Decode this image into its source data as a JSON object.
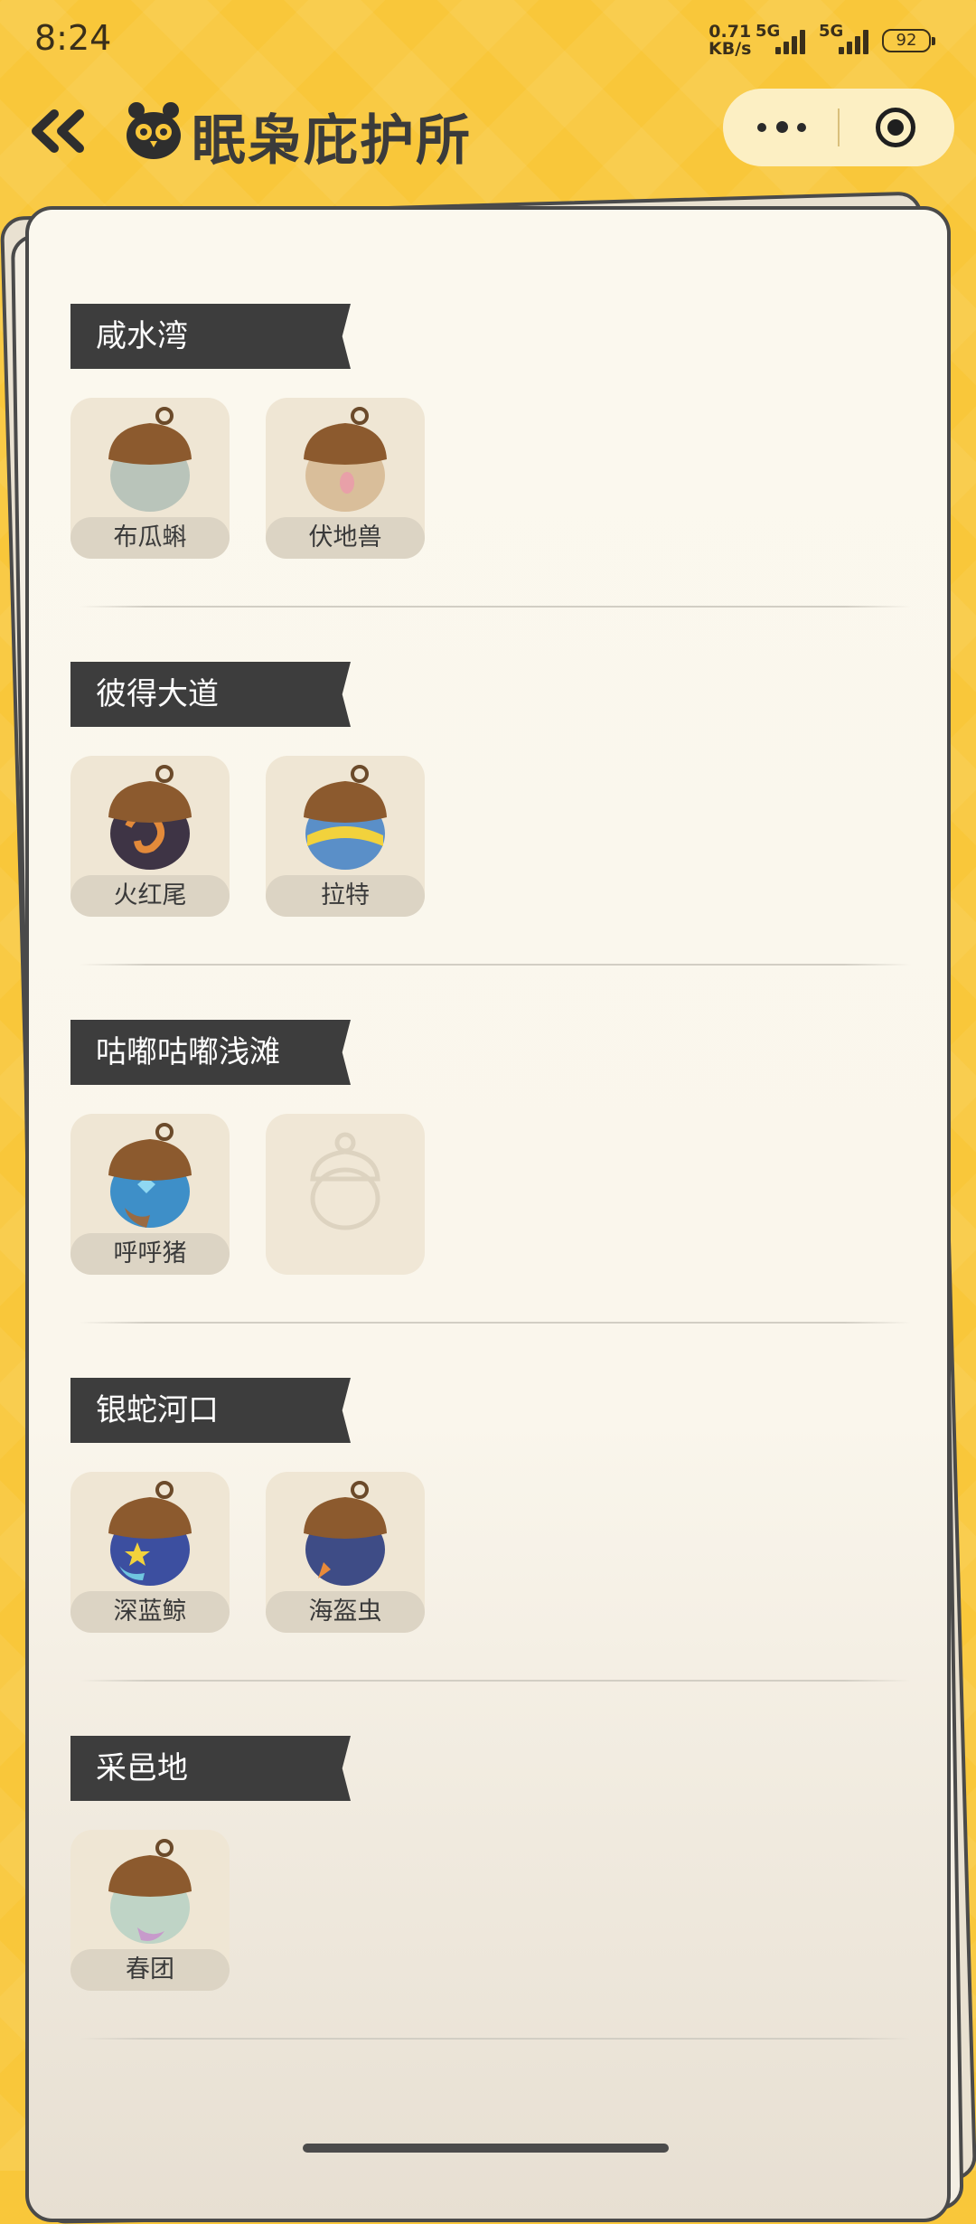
{
  "status_bar": {
    "time": "8:24",
    "net_speed_value": "0.71",
    "net_speed_unit": "KB/s",
    "signal_1": "5G",
    "signal_2": "5G",
    "battery": "92"
  },
  "header": {
    "title": "眠枭庇护所",
    "icons": [
      "back-double-chevron-icon",
      "owl-logo-icon",
      "more-icon",
      "close-target-icon"
    ]
  },
  "sections": [
    {
      "title": "咸水湾",
      "items": [
        {
          "name": "布瓜蝌",
          "color": "#B9C4BA"
        },
        {
          "name": "伏地兽",
          "color": "#D9BE9A"
        }
      ]
    },
    {
      "title": "彼得大道",
      "items": [
        {
          "name": "火红尾",
          "color": "#3E3445"
        },
        {
          "name": "拉特",
          "color": "#5A8FC8"
        }
      ]
    },
    {
      "title": "咕嘟咕嘟浅滩",
      "items": [
        {
          "name": "呼呼猪",
          "color": "#3E8FC8"
        }
      ]
    },
    {
      "title": "银蛇河口",
      "items": [
        {
          "name": "深蓝鲸",
          "color": "#3C4FA0"
        },
        {
          "name": "海盔虫",
          "color": "#3E4C86"
        }
      ]
    },
    {
      "title": "采邑地",
      "items": [
        {
          "name": "春团",
          "color": "#BFD4C6"
        }
      ]
    }
  ],
  "theme": {
    "accent": "#F9C73A",
    "label_bg": "#3D3D3D",
    "paper": "#FBF8EE"
  }
}
